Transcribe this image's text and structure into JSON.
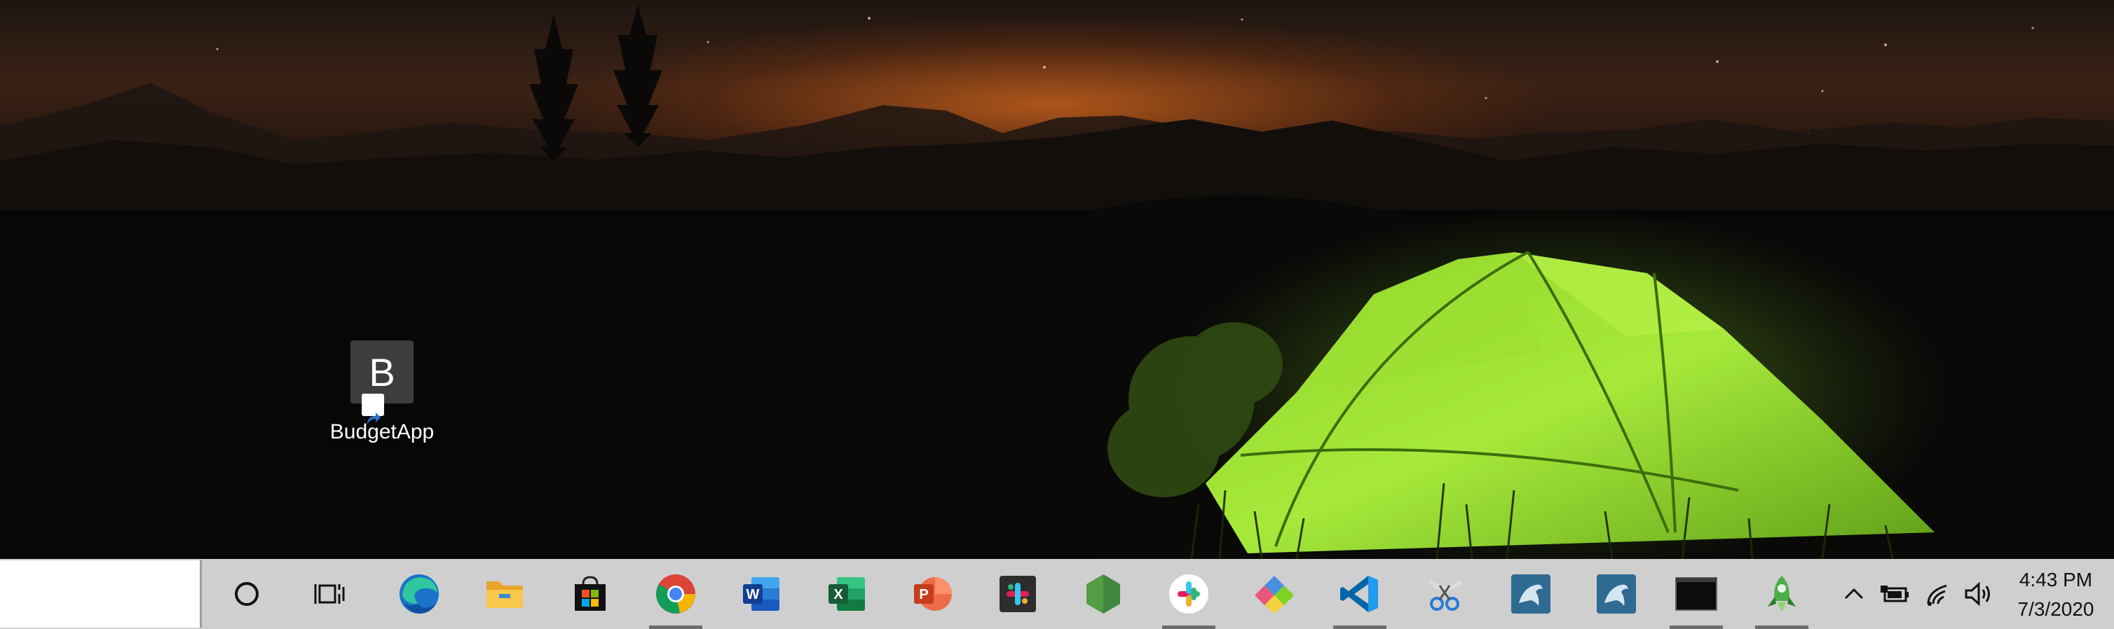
{
  "desktop": {
    "wallpaper": "night-camping-tent",
    "icons": [
      {
        "label": "BudgetApp",
        "tile_letter": "B",
        "tile_color": "#3d3d3d"
      }
    ]
  },
  "taskbar": {
    "background": "#cfcfcf",
    "search_placeholder": "",
    "buttons": [
      {
        "name": "cortana",
        "icon": "cortana-circle-icon"
      },
      {
        "name": "task-view",
        "icon": "task-view-icon"
      },
      {
        "name": "microsoft-edge",
        "icon": "edge-icon"
      },
      {
        "name": "file-explorer",
        "icon": "folder-icon"
      },
      {
        "name": "microsoft-store",
        "icon": "store-bag-icon"
      },
      {
        "name": "google-chrome",
        "icon": "chrome-icon",
        "running": true
      },
      {
        "name": "microsoft-word",
        "icon": "word-icon",
        "letter": "W"
      },
      {
        "name": "microsoft-excel",
        "icon": "excel-icon",
        "letter": "X"
      },
      {
        "name": "microsoft-powerpoint",
        "icon": "powerpoint-icon",
        "letter": "P"
      },
      {
        "name": "slack-workspace",
        "icon": "slack-square-icon"
      },
      {
        "name": "nodejs",
        "icon": "nodejs-hexagon-icon"
      },
      {
        "name": "slack",
        "icon": "slack-icon",
        "running": true
      },
      {
        "name": "app-launcher",
        "icon": "diamond-tiles-icon"
      },
      {
        "name": "visual-studio-code",
        "icon": "vscode-icon",
        "running": true
      },
      {
        "name": "snipping-tool",
        "icon": "scissors-icon"
      },
      {
        "name": "mysql-workbench",
        "icon": "dolphin-icon"
      },
      {
        "name": "mysql-workbench-2",
        "icon": "dolphin-icon"
      },
      {
        "name": "terminal",
        "icon": "terminal-icon",
        "running": true
      },
      {
        "name": "rocket-app",
        "icon": "rocket-icon",
        "running": true
      }
    ]
  },
  "tray": {
    "icons": [
      "chevron-up-icon",
      "battery-icon",
      "wifi-icon",
      "volume-icon"
    ],
    "time": "4:43 PM",
    "date": "7/3/2020"
  }
}
